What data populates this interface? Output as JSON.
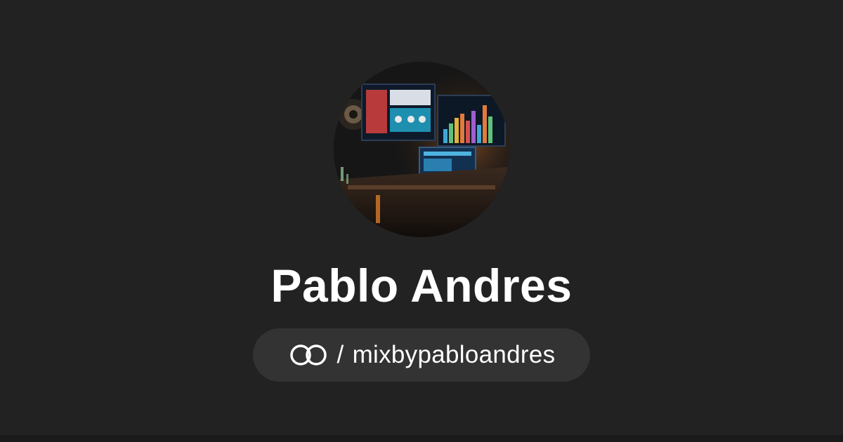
{
  "profile": {
    "name": "Pablo Andres",
    "handle_separator": "/",
    "handle": "mixbypabloandres",
    "avatar_icon": "studio-avatar-image",
    "link_icon": "link-rings-icon"
  },
  "colors": {
    "background": "#222222",
    "pill": "#333333",
    "text": "#ffffff"
  }
}
